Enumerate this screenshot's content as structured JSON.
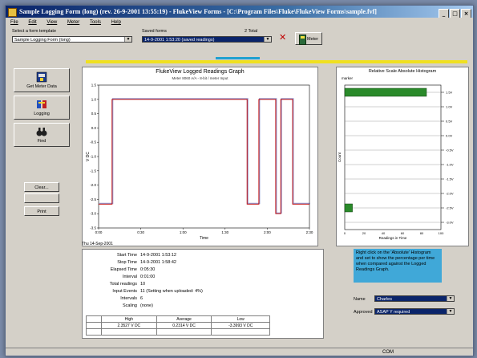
{
  "window": {
    "title": "Sample Logging Form (long) (rev. 26-9-2001 13:55:19) - FlukeView Forms - [C:\\Program Files\\Fluke\\FlukeView Forms\\sample.fvf]",
    "controls": [
      "_",
      "□",
      "×"
    ]
  },
  "menu": [
    "File",
    "Edit",
    "View",
    "Meter",
    "Tools",
    "Help"
  ],
  "template": {
    "label": "Select a form template",
    "value": "Sample Logging Form (long)"
  },
  "saved": {
    "label": "Saved forms",
    "value": "14-9-2001 1:53:20 (saved readings)",
    "count_label": "2 Total"
  },
  "meter_button": "Meter",
  "sidebar": {
    "get_meter_data": "Get Meter Data",
    "logging": "Logging",
    "find": "Find",
    "clear": "Clear...",
    "blank": "",
    "print": "Print"
  },
  "graph": {
    "title": "FlukeView Logged Readings Graph",
    "subtitle": "Meter 8060 A/A - 8-bit / meter Input",
    "ylabel": "V DC",
    "xlabel": "Time",
    "bottom_left_label": "Thu 14-Sep-2001",
    "yticks": [
      "1.5",
      "1.0",
      "0.5",
      "0.0",
      "-0.5",
      "-1.0",
      "-1.5",
      "-2.0",
      "-2.5",
      "-3.0",
      "-3.5"
    ],
    "xticks": [
      "0:00",
      "0:30",
      "1:00",
      "1:30",
      "2:00",
      "2:30"
    ],
    "color_series": "#c00000",
    "color_envelope": "#4040a0"
  },
  "chart_data": {
    "type": "line",
    "title": "FlukeView Logged Readings Graph",
    "xlabel": "Time",
    "ylabel": "V DC",
    "ylim": [
      -4,
      2
    ],
    "series": [
      {
        "x": [
          0,
          8,
          8,
          88,
          88,
          95,
          95,
          105,
          105,
          108,
          108,
          115,
          115,
          125
        ],
        "values": [
          -3.0,
          -3.0,
          1.4,
          1.4,
          -3.0,
          -3.0,
          1.4,
          1.4,
          -3.4,
          -3.4,
          1.4,
          1.4,
          -3.0,
          -3.0
        ]
      }
    ]
  },
  "histogram": {
    "title": "Relative Scale Absolute Histogram",
    "ylabel": "Count",
    "xlabel": "Readings in Time",
    "top_label": "marker",
    "right_labels": [
      "1.5V",
      "1.0V",
      "0.5V",
      "0.0V",
      "-0.5V",
      "-1.0V",
      "-1.5V",
      "-2.0V",
      "-2.5V",
      "-3.0V"
    ],
    "bars": [
      {
        "bin": "1.2 V",
        "percent": 85
      },
      {
        "bin": "-3.0 V",
        "percent": 8
      }
    ],
    "xticks": [
      "0",
      "20",
      "40",
      "60",
      "80",
      "100"
    ]
  },
  "info": {
    "rows": [
      {
        "k": "Start Time",
        "v": "14-9-2001 1:53:12"
      },
      {
        "k": "Stop Time",
        "v": "14-9-2001 1:58:42"
      },
      {
        "k": "Elapsed Time",
        "v": "0:05:30"
      },
      {
        "k": "Interval",
        "v": "0:01:00"
      },
      {
        "k": "Total readings",
        "v": "10"
      },
      {
        "k": "Input Events",
        "v": "11  (Setting when uploaded: 4%)"
      },
      {
        "k": "Intervals",
        "v": "6"
      },
      {
        "k": "Scaling",
        "v": "(none)"
      }
    ],
    "stats_headers": [
      "High",
      "Average",
      "Low"
    ],
    "stats_values": [
      "2.3527 V DC",
      "0.2314 V DC",
      "-3.3993 V DC"
    ]
  },
  "help_text": "Right click on the 'Absolute' Histogram and set to show the percentage per time when compared against the Logged Readings Graph.",
  "right_fields": [
    {
      "label": "Name",
      "value": "Charles"
    },
    {
      "label": "Approved",
      "value": "ASAP Y required"
    }
  ],
  "status": {
    "left": "",
    "right": "COM"
  }
}
